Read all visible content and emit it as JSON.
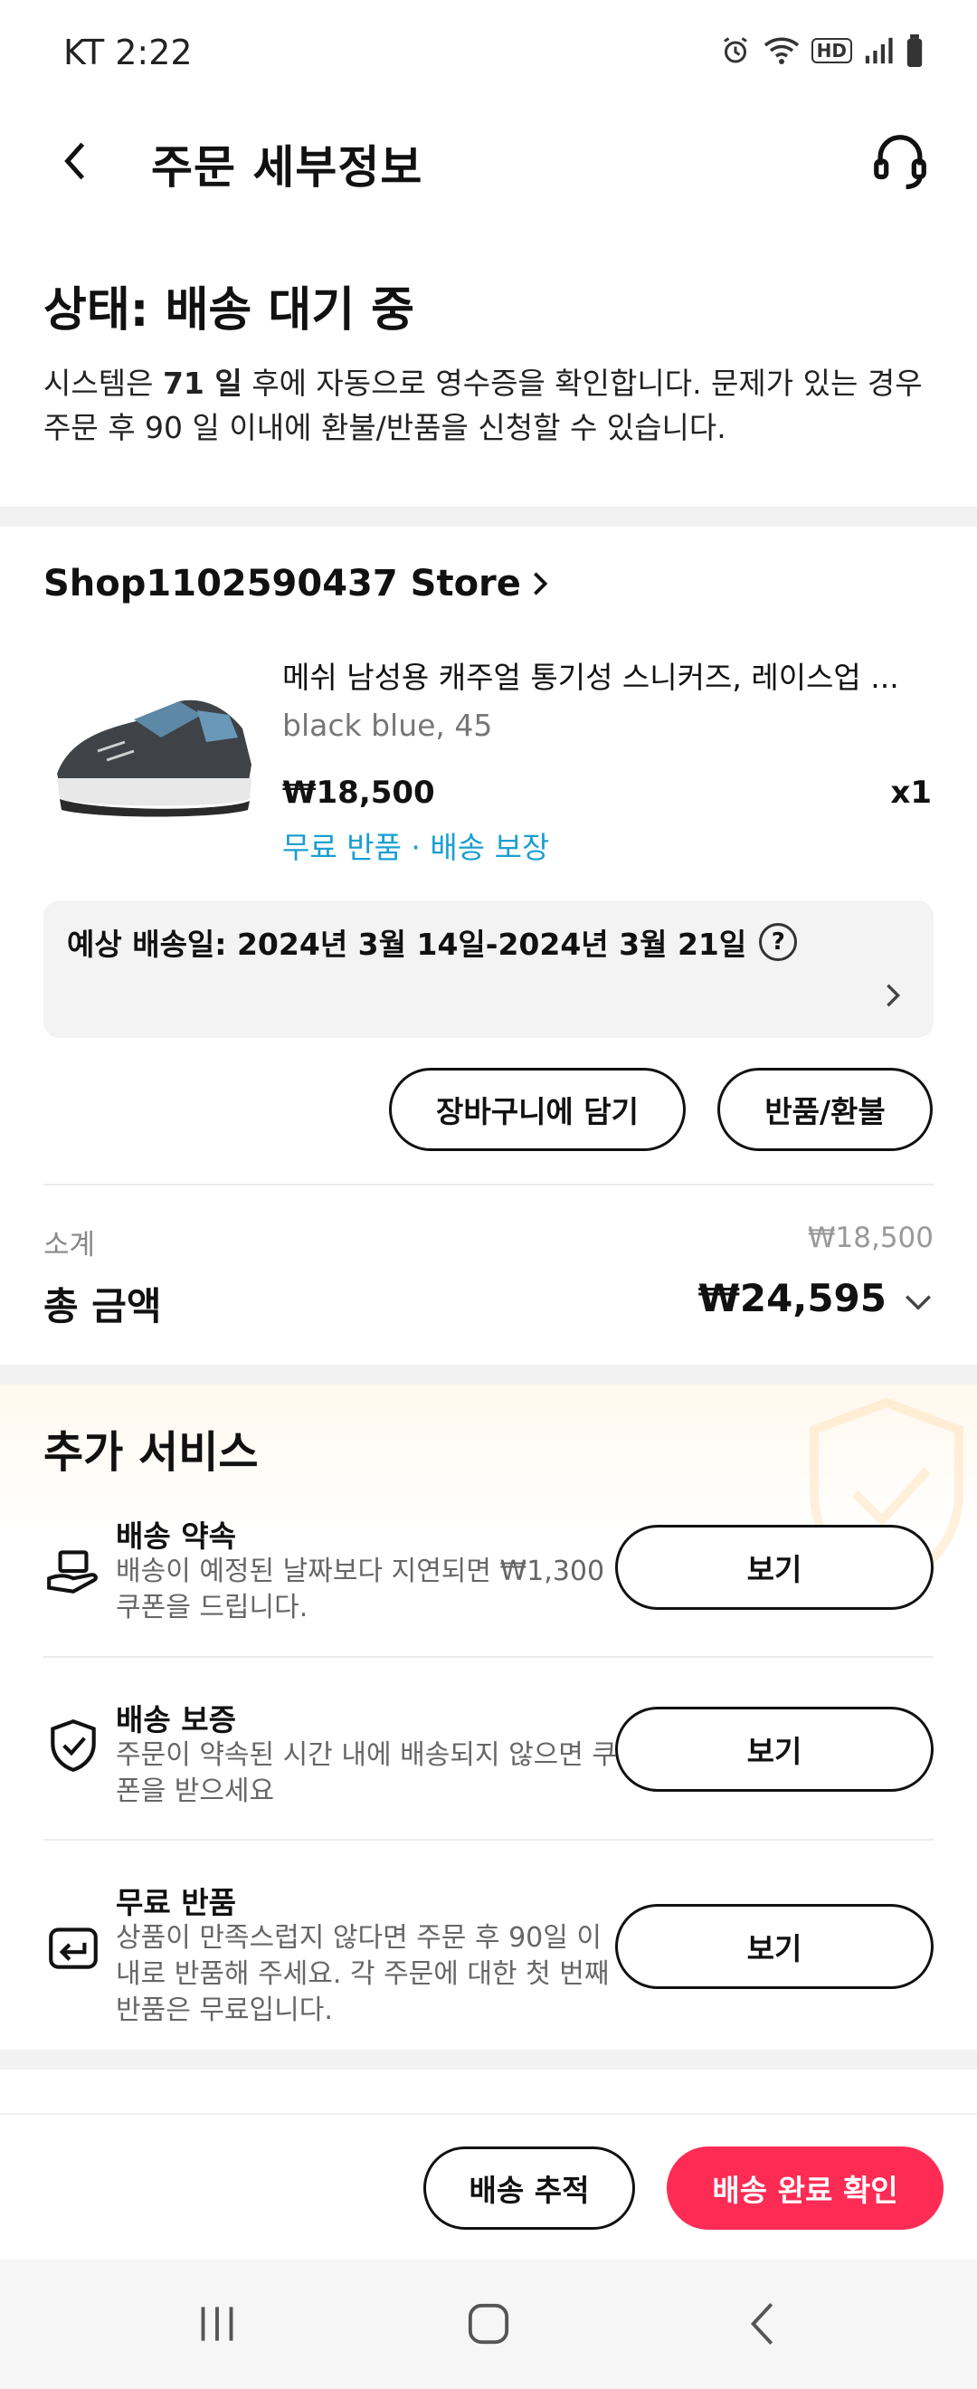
{
  "status_bar": {
    "carrier_time": "KT 2:22",
    "icons": [
      "alarm-icon",
      "wifi-icon",
      "hd-icon",
      "signal-icon",
      "battery-icon"
    ],
    "hd_label": "HD"
  },
  "header": {
    "title": "주문 세부정보"
  },
  "order_status": {
    "title": "상태: 배송 대기 중",
    "desc_prefix": "시스템은 ",
    "days": "71 일",
    "desc_suffix": " 후에 자동으로 영수증을 확인합니다. 문제가 있는 경우 주문 후 90 일 이내에 환불/반품을 신청할 수 있습니다."
  },
  "store": {
    "name": "Shop1102590437 Store"
  },
  "product": {
    "title": "메쉬 남성용 캐주얼 통기성 스니커즈, 레이스업 ...",
    "variant": "black blue, 45",
    "price": "₩18,500",
    "qty": "x1",
    "perks": "무료 반품 · 배송 보장"
  },
  "eta": {
    "text": "예상 배송일: 2024년 3월 14일-2024년 3월 21일",
    "help": "?"
  },
  "actions": {
    "add_to_cart": "장바구니에 담기",
    "return_refund": "반품/환불"
  },
  "totals": {
    "subtotal_label": "소계",
    "subtotal_value": "₩18,500",
    "total_label": "총 금액",
    "total_value": "₩24,595"
  },
  "services": {
    "title": "추가 서비스",
    "items": [
      {
        "name": "배송 약속",
        "desc": "배송이 예정된 날짜보다 지연되면 ₩1,300 쿠폰을 드립니다.",
        "button": "보기",
        "icon": "delivery-promise-icon"
      },
      {
        "name": "배송 보증",
        "desc": "주문이 약속된 시간 내에 배송되지 않으면 쿠폰을 받으세요",
        "button": "보기",
        "icon": "shield-check-icon"
      },
      {
        "name": "무료 반품",
        "desc": "상품이 만족스럽지 않다면 주문 후 90일 이내로 반품해 주세요. 각 주문에 대한 첫 번째 반품은 무료입니다.",
        "button": "보기",
        "icon": "return-icon"
      }
    ]
  },
  "bottom_actions": {
    "track": "배송 추적",
    "confirm": "배송 완료 확인"
  },
  "colors": {
    "accent": "#fe2c55",
    "perk_blue": "#1a9fd0"
  }
}
